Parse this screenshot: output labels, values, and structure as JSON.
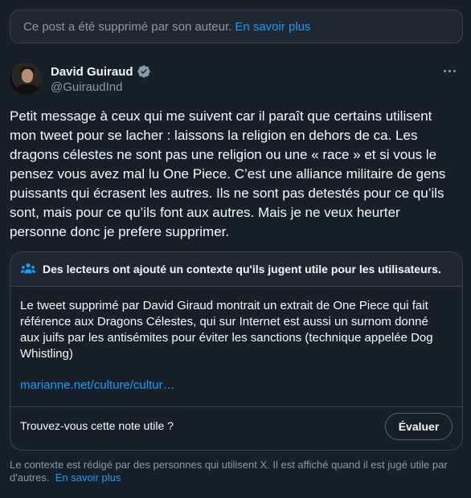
{
  "deleted_notice": {
    "text": "Ce post a été supprimé par son auteur.",
    "link": "En savoir plus"
  },
  "author": {
    "name": "David Guiraud",
    "handle": "@GuiraudInd",
    "verified_icon": "verified-badge-icon",
    "more_icon": "more-icon"
  },
  "tweet": {
    "text": "Petit message à ceux qui me suivent car il paraît que certains utilisent mon tweet pour se lacher : laissons la religion en dehors de ca. Les dragons célestes ne sont pas une religion ou une « race » et si vous le pensez vous avez mal lu One Piece. C’est une alliance militaire de gens puissants qui écrasent les autres. Ils ne sont pas detestés pour ce qu’ils sont, mais pour ce qu’ils font aux autres. Mais je ne veux heurter personne donc je prefere supprimer."
  },
  "community_note": {
    "header_icon": "people-icon",
    "title": "Des lecteurs ont ajouté un contexte qu'ils jugent utile pour les utilisateurs.",
    "body": "Le tweet supprimé par David Giraud montrait un extrait de One Piece qui fait référence aux Dragons Célestes, qui sur Internet est aussi un surnom donné aux juifs par les antisémites pour éviter les sanctions (technique appelée Dog Whistling)",
    "link": "marianne.net/culture/cultur…",
    "question": "Trouvez-vous cette note utile ?",
    "rate_button": "Évaluer"
  },
  "footer": {
    "text": "Le contexte est rédigé par des personnes qui utilisent X. Il est affiché quand il est jugé utile par d'autres.",
    "link": "En savoir plus"
  },
  "colors": {
    "background": "#15202b",
    "accent": "#1d9bf0",
    "border": "#38444d",
    "muted_text": "#8b98a5"
  }
}
